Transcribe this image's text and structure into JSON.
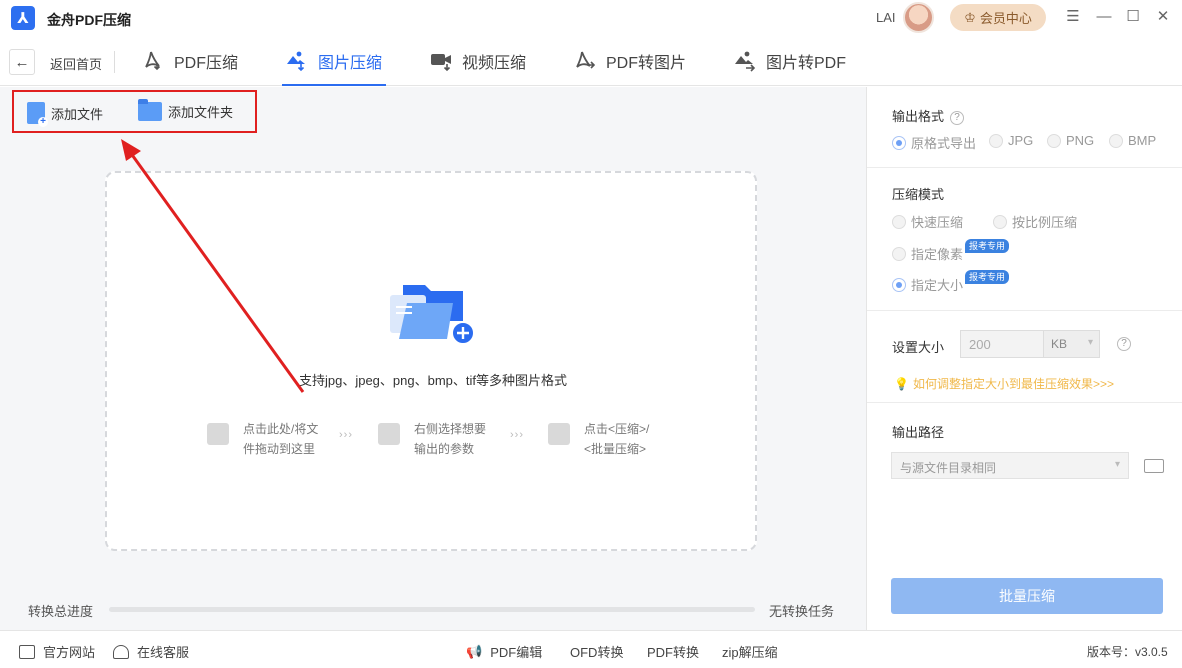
{
  "app": {
    "title": "金舟PDF压缩",
    "logo_glyph": "⅄"
  },
  "user": {
    "name": "LAI",
    "member_label": "会员中心"
  },
  "window_controls": {
    "menu": "☰",
    "minimize": "—",
    "maximize": "☐",
    "close": "✕"
  },
  "nav": {
    "back_label": "返回首页",
    "tabs": [
      {
        "label": "PDF压缩",
        "icon": "pdf-compress-icon",
        "active": false
      },
      {
        "label": "图片压缩",
        "icon": "image-compress-icon",
        "active": true
      },
      {
        "label": "视频压缩",
        "icon": "video-compress-icon",
        "active": false
      },
      {
        "label": "PDF转图片",
        "icon": "pdf-to-image-icon",
        "active": false
      },
      {
        "label": "图片转PDF",
        "icon": "image-to-pdf-icon",
        "active": false
      }
    ]
  },
  "toolbar": {
    "add_file": "添加文件",
    "add_folder": "添加文件夹"
  },
  "dropzone": {
    "support_text": "支持jpg、jpeg、png、bmp、tif等多种图片格式",
    "steps": [
      {
        "line1": "点击此处/将文",
        "line2": "件拖动到这里"
      },
      {
        "line1": "右侧选择想要",
        "line2": "输出的参数"
      },
      {
        "line1": "点击<压缩>/",
        "line2": "<批量压缩>"
      }
    ],
    "step_separator": "›››"
  },
  "progress": {
    "label": "转换总进度",
    "status": "无转换任务",
    "value": 0
  },
  "settings": {
    "output_format": {
      "title": "输出格式",
      "options": [
        "原格式导出",
        "JPG",
        "PNG",
        "BMP"
      ],
      "selected": "原格式导出"
    },
    "compress_mode": {
      "title": "压缩模式",
      "options": [
        "快速压缩",
        "按比例压缩",
        "指定像素",
        "指定大小"
      ],
      "selected": "指定大小",
      "badge": "报考专用"
    },
    "size": {
      "title": "设置大小",
      "value": "200",
      "unit": "KB"
    },
    "tip": "如何调整指定大小到最佳压缩效果>>>",
    "output_path": {
      "title": "输出路径",
      "value": "与源文件目录相同"
    },
    "batch_button": "批量压缩"
  },
  "footer": {
    "website": "官方网站",
    "service": "在线客服",
    "links": [
      "PDF编辑",
      "OFD转换",
      "PDF转换",
      "zip解压缩"
    ],
    "version": "版本号：v3.0.5"
  },
  "colors": {
    "accent": "#2b6cf0",
    "highlight_box": "#e02020",
    "member_bg": "#f4dcc4"
  }
}
